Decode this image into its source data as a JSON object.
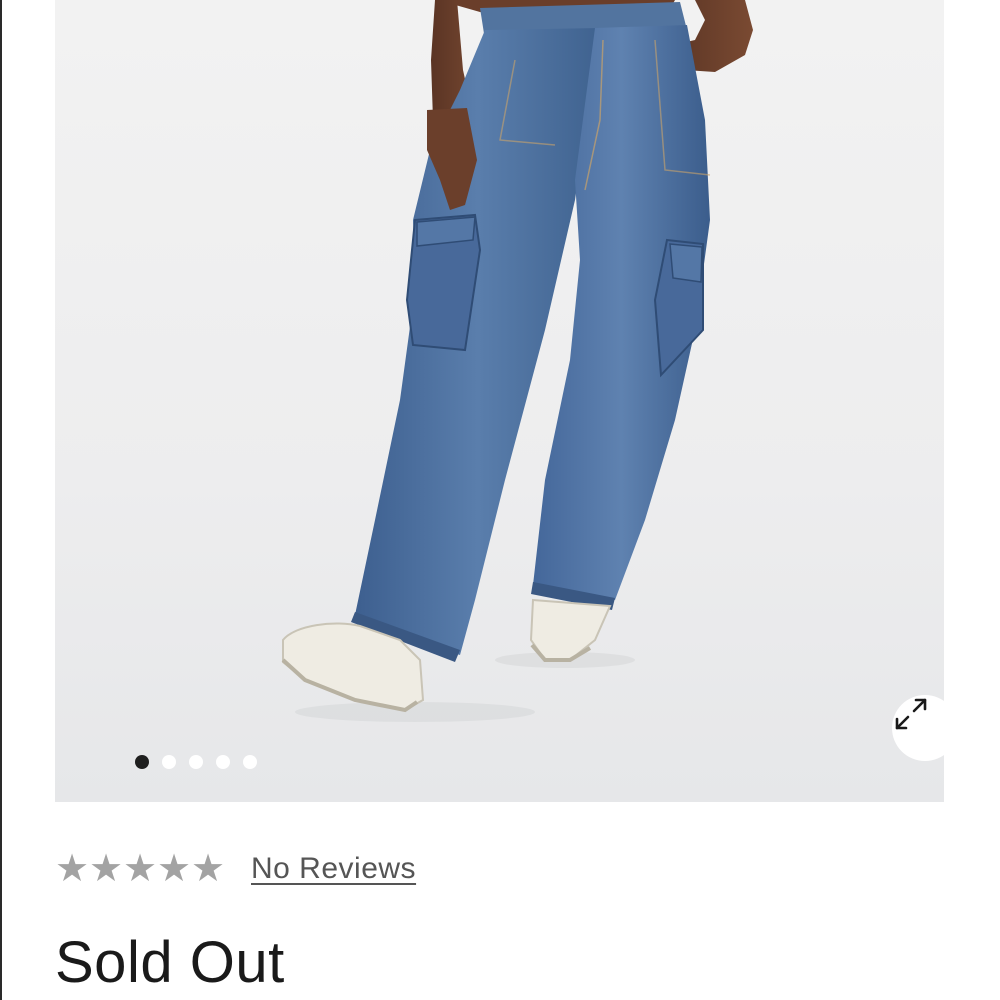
{
  "product": {
    "image_alt": "Model wearing wide-leg cargo jeans",
    "carousel": {
      "count": 5,
      "active_index": 0
    },
    "rating": {
      "stars_filled": 0,
      "stars_total": 5,
      "reviews_label": "No Reviews"
    },
    "status": "Sold Out"
  },
  "icons": {
    "expand": "expand-arrows-icon",
    "star": "star-icon"
  },
  "colors": {
    "star": "#a3a3a3",
    "dot_active": "#1f1f1f",
    "dot_inactive": "#ffffff",
    "denim": "#4b6e9c"
  }
}
